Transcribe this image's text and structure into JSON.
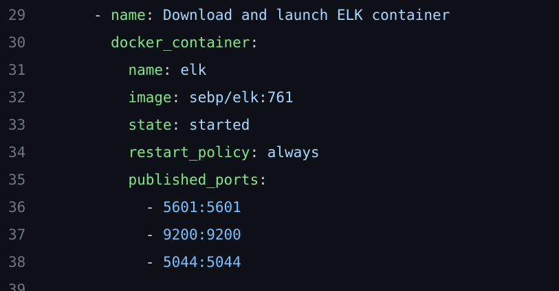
{
  "lines": [
    {
      "num": "29",
      "dash": "- ",
      "key": "name",
      "colon": ": ",
      "value": "Download and launch ELK container"
    },
    {
      "num": "30",
      "key": "docker_container",
      "colon": ":"
    },
    {
      "num": "31",
      "key": "name",
      "colon": ": ",
      "value": "elk"
    },
    {
      "num": "32",
      "key": "image",
      "colon": ": ",
      "value": "sebp/elk:761"
    },
    {
      "num": "33",
      "key": "state",
      "colon": ": ",
      "value": "started"
    },
    {
      "num": "34",
      "key": "restart_policy",
      "colon": ": ",
      "value": "always"
    },
    {
      "num": "35",
      "key": "published_ports",
      "colon": ":"
    },
    {
      "num": "36",
      "dash": "- ",
      "value": "5601:5601"
    },
    {
      "num": "37",
      "dash": "- ",
      "value": "9200:9200"
    },
    {
      "num": "38",
      "dash": "- ",
      "value": "5044:5044"
    },
    {
      "num": "39"
    }
  ]
}
